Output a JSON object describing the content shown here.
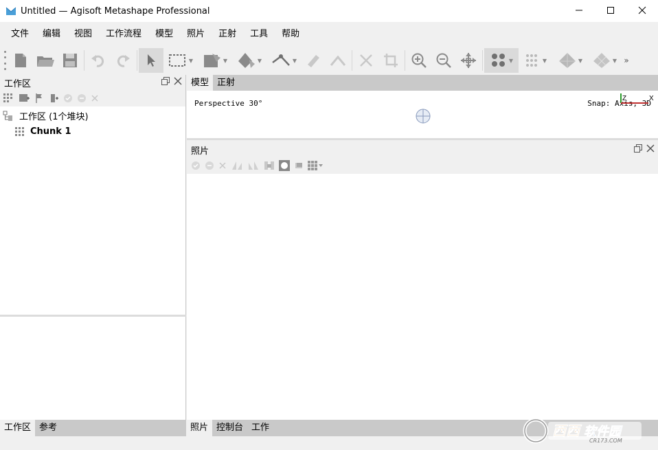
{
  "window": {
    "title": "Untitled — Agisoft Metashape Professional",
    "icon": "metashape-app-icon",
    "controls": [
      "minimize-icon",
      "maximize-icon",
      "close-icon"
    ]
  },
  "menu": {
    "items": [
      "文件",
      "编辑",
      "视图",
      "工作流程",
      "模型",
      "照片",
      "正射",
      "工具",
      "帮助"
    ]
  },
  "toolbar": {
    "buttons": [
      "new-document-icon",
      "open-folder-icon",
      "save-icon",
      "undo-icon",
      "redo-icon",
      "select-pointer-icon",
      "rectangle-selection-icon",
      "shape-draw-icon",
      "navigation-icon",
      "ruler-line-icon",
      "ruler-icon",
      "angle-icon",
      "delete-icon",
      "crop-icon",
      "zoom-in-icon",
      "zoom-out-icon",
      "reset-view-icon",
      "point-cloud-icon",
      "dense-cloud-icon",
      "model-icon",
      "tiled-model-icon",
      "more-icon"
    ]
  },
  "workspace": {
    "header": "工作区",
    "root_label": "工作区 (1个堆块)",
    "chunk_label": "Chunk 1"
  },
  "model_view": {
    "tabs": [
      "模型",
      "正射"
    ],
    "perspective": "Perspective 30°",
    "snap": "Snap: Axis, 3D",
    "axis_z": "Z",
    "axis_x": "X"
  },
  "photos": {
    "header": "照片"
  },
  "bottom_tabs_left": [
    "工作区",
    "参考"
  ],
  "bottom_tabs_right": [
    "照片",
    "控制台",
    "工作"
  ],
  "watermark": {
    "text": "西西软件园",
    "sub": "CR173.COM"
  }
}
